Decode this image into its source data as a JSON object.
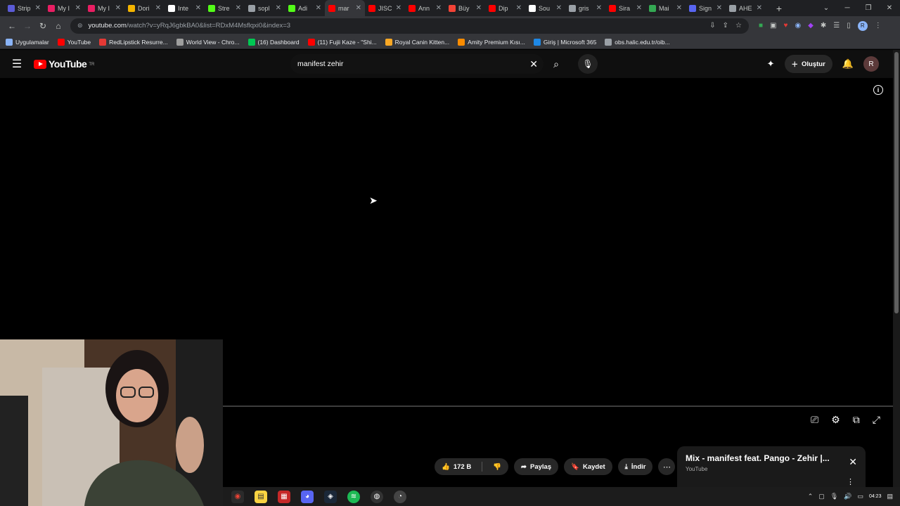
{
  "tabs": [
    {
      "title": "Strip",
      "color": "#5b5bd6"
    },
    {
      "title": "My I",
      "color": "#e91e63"
    },
    {
      "title": "My I",
      "color": "#e91e63"
    },
    {
      "title": "Dori",
      "color": "#f4b400"
    },
    {
      "title": "Inte",
      "color": "#ffffff"
    },
    {
      "title": "Stre",
      "color": "#53fc18"
    },
    {
      "title": "sopl",
      "color": "#9aa0a6"
    },
    {
      "title": "Adi",
      "color": "#53fc18"
    },
    {
      "title": "mar",
      "color": "#ff0000",
      "active": true
    },
    {
      "title": "JISC",
      "color": "#ff0000"
    },
    {
      "title": "Ann",
      "color": "#ff0000"
    },
    {
      "title": "Büy",
      "color": "#f44336"
    },
    {
      "title": "Dip",
      "color": "#ff0000"
    },
    {
      "title": "Sou",
      "color": "#ffffff"
    },
    {
      "title": "gris",
      "color": "#9aa0a6"
    },
    {
      "title": "Sira",
      "color": "#ff0000"
    },
    {
      "title": "Mai",
      "color": "#34a853"
    },
    {
      "title": "Sign",
      "color": "#5865f2"
    },
    {
      "title": "AHE",
      "color": "#9aa0a6"
    }
  ],
  "browser": {
    "url_host": "youtube.com",
    "url_path": "/watch?v=yRqJ6gbkBA0&list=RDxM4Msflqxi0&index=3",
    "new_tab": "+"
  },
  "bookmarks": [
    {
      "label": "Uygulamalar",
      "color": "#8ab4f8"
    },
    {
      "label": "YouTube",
      "color": "#ff0000"
    },
    {
      "label": "RedLipstick Resurre...",
      "color": "#e53935"
    },
    {
      "label": "World View - Chro...",
      "color": "#9e9e9e"
    },
    {
      "label": "(16) Dashboard",
      "color": "#00c853"
    },
    {
      "label": "(11) Fujii Kaze - \"Shi...",
      "color": "#ff0000"
    },
    {
      "label": "Royal Canin Kitten...",
      "color": "#f9a825"
    },
    {
      "label": "Amity Premium Kısı...",
      "color": "#fb8c00"
    },
    {
      "label": "Giriş | Microsoft 365",
      "color": "#1e88e5"
    },
    {
      "label": "obs.halic.edu.tr/oib...",
      "color": "#9aa0a6"
    }
  ],
  "youtube": {
    "logo_text": "YouTube",
    "region": "TR",
    "search_query": "manifest zehir",
    "create_label": "Oluştur",
    "avatar_letter": "R"
  },
  "actions": {
    "likes": "172 B",
    "share": "Paylaş",
    "save": "Kaydet",
    "download": "İndir"
  },
  "mix": {
    "title": "Mix - manifest feat. Pango - Zehir |...",
    "channel": "YouTube"
  },
  "taskbar": {
    "time": "04:23"
  },
  "icons": [
    "menu-icon",
    "search-icon",
    "mic-icon",
    "create-icon",
    "bell-icon",
    "info-icon",
    "subtitles-icon",
    "settings-icon",
    "miniplayer-icon",
    "fullscreen-icon",
    "like-icon",
    "dislike-icon",
    "share-icon",
    "save-icon",
    "download-icon",
    "more-icon"
  ]
}
